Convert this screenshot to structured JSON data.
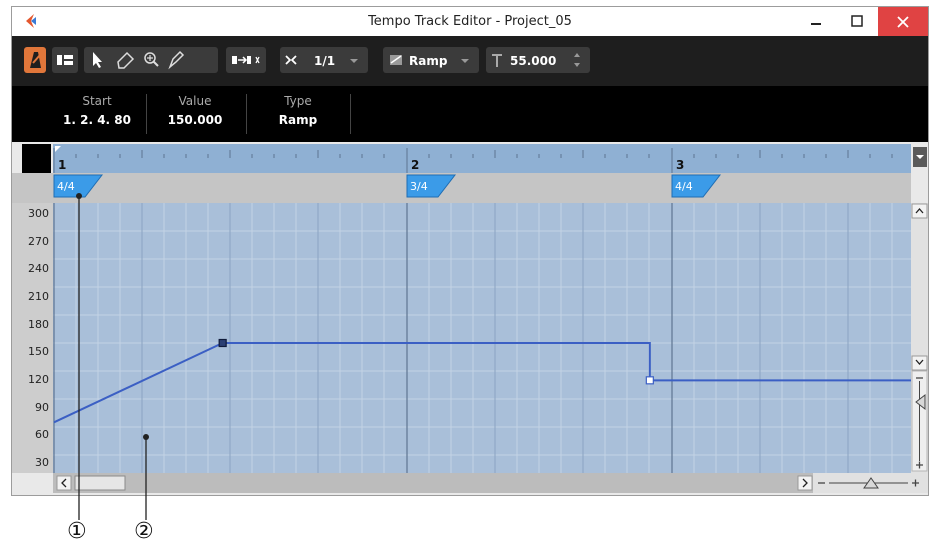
{
  "window": {
    "title": "Tempo Track Editor - Project_05",
    "min_icon": "minimize-icon",
    "max_icon": "maximize-icon",
    "close_icon": "close-icon"
  },
  "toolbar": {
    "snap_value": "1/1",
    "curve_type": "Ramp",
    "tempo_value": "55.000"
  },
  "info": {
    "start_label": "Start",
    "start_value": "1. 2. 4. 80",
    "value_label": "Value",
    "value_value": "150.000",
    "type_label": "Type",
    "type_value": "Ramp"
  },
  "ruler": {
    "bars": [
      "1",
      "2",
      "3"
    ]
  },
  "signatures": [
    "4/4",
    "3/4",
    "4/4"
  ],
  "value_axis": [
    "300",
    "270",
    "240",
    "210",
    "180",
    "150",
    "120",
    "90",
    "60",
    "30"
  ],
  "tempo_points": [
    {
      "bar": "1. 1. 1. 0",
      "bpm": 65
    },
    {
      "bar": "1. 2. 4. 80",
      "bpm": 150
    },
    {
      "bar": "2. 3. 4. 0",
      "bpm": 150
    },
    {
      "bar": "2. 3. 4. 0",
      "bpm": 110
    }
  ],
  "callouts": [
    "①",
    "②"
  ],
  "colors": {
    "accent": "#e0763a",
    "grid_bg": "#a9bfd9",
    "tempo_line": "#3b5fc4",
    "signature_flag": "#3b9be8",
    "close_button": "#e04343"
  }
}
